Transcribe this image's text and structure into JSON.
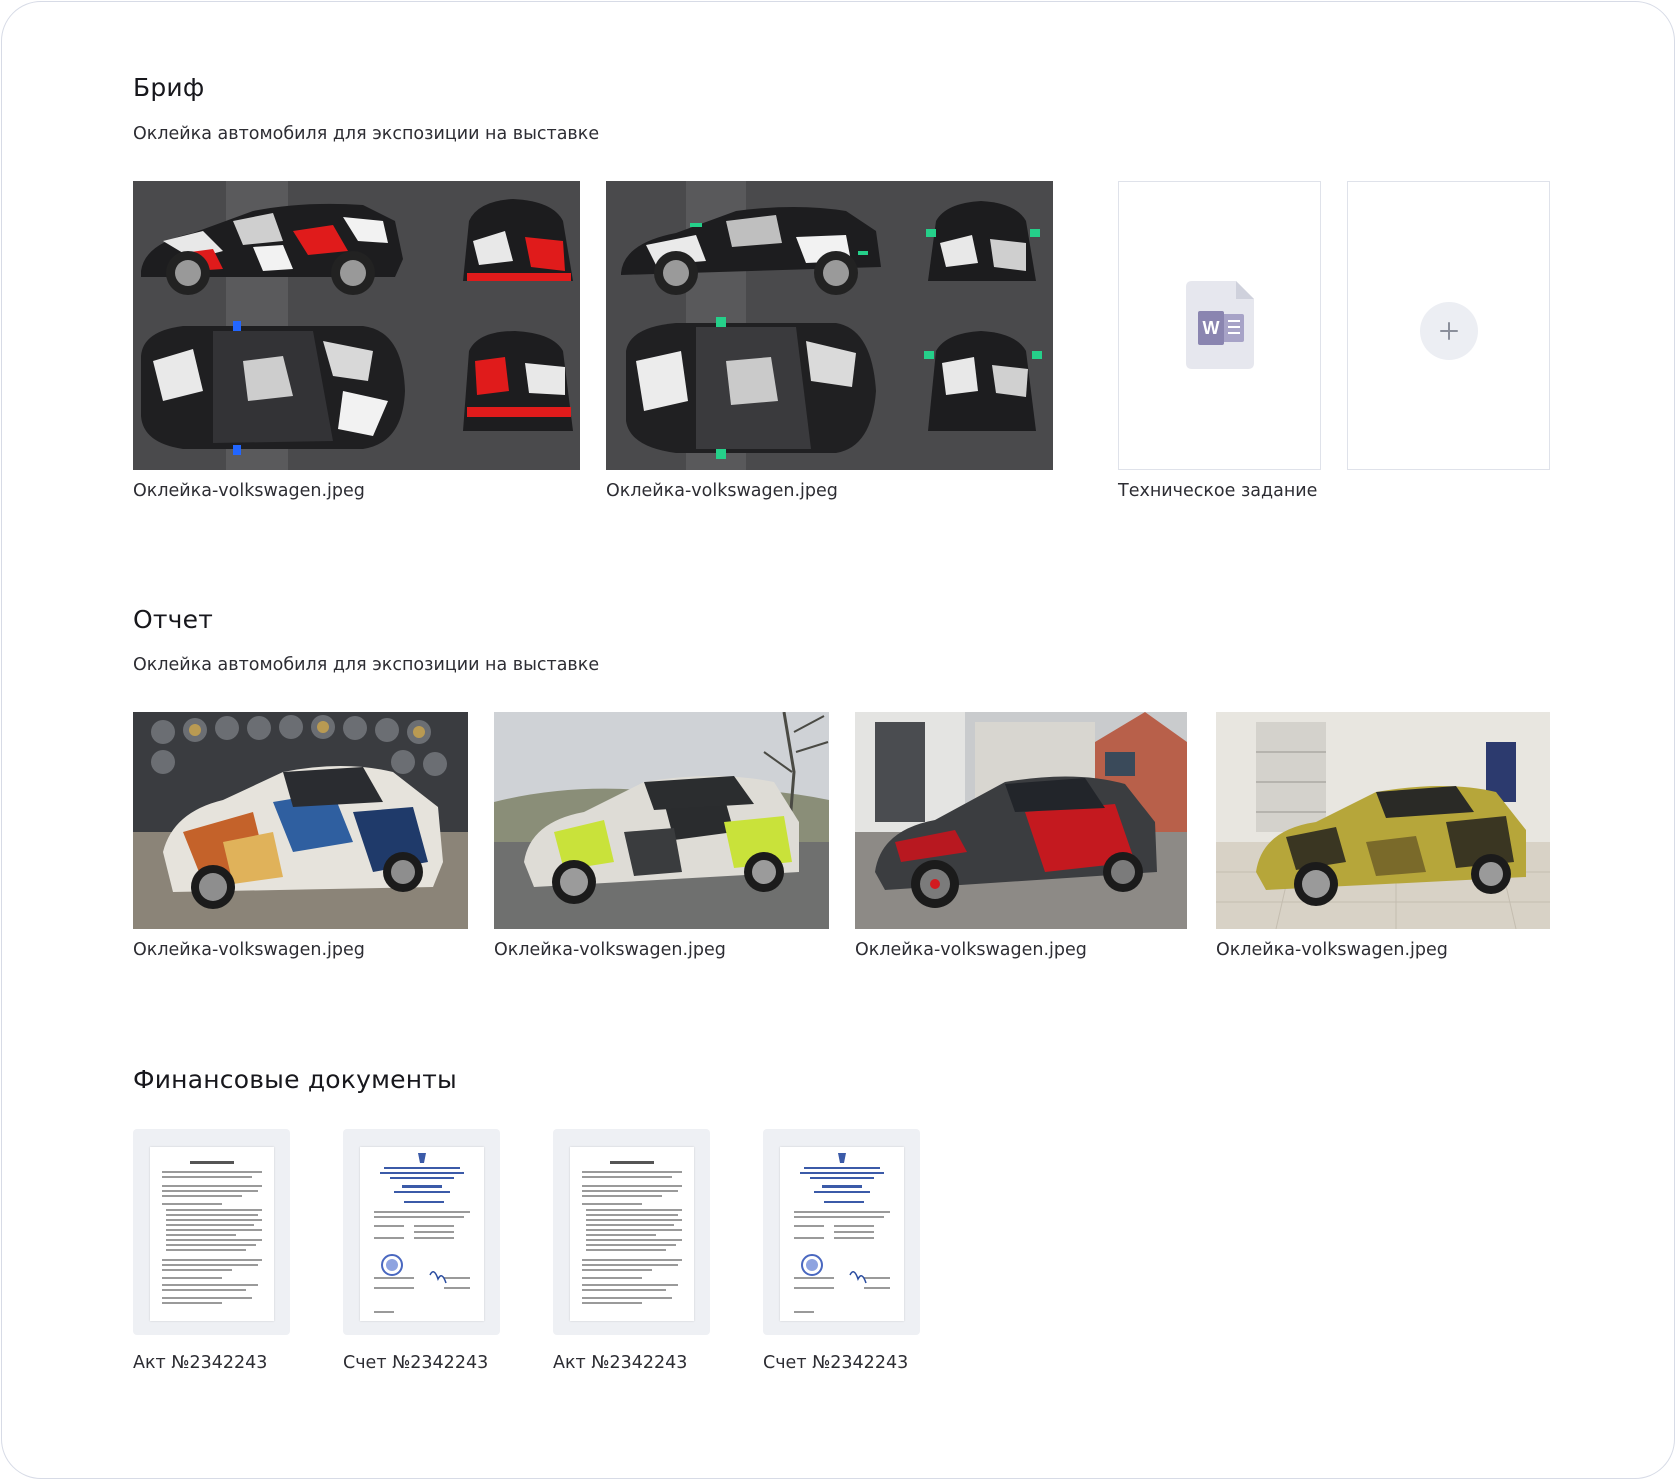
{
  "brief": {
    "title": "Бриф",
    "subtitle": "Оклейка автомобиля для экспозиции на выставке",
    "files": [
      {
        "name": "Оклейка-volkswagen.jpeg",
        "kind": "image"
      },
      {
        "name": "Оклейка-volkswagen.jpeg",
        "kind": "image"
      },
      {
        "name": "Техническое задание",
        "kind": "word-document",
        "icon": "word-icon"
      }
    ],
    "add_icon": "plus-icon"
  },
  "report": {
    "title": "Отчет",
    "subtitle": "Оклейка автомобиля для экспозиции на выставке",
    "files": [
      {
        "name": "Оклейка-volkswagen.jpeg"
      },
      {
        "name": "Оклейка-volkswagen.jpeg"
      },
      {
        "name": "Оклейка-volkswagen.jpeg"
      },
      {
        "name": "Оклейка-volkswagen.jpeg"
      }
    ]
  },
  "finance": {
    "title": "Финансовые документы",
    "files": [
      {
        "name": "Акт №2342243"
      },
      {
        "name": "Счет №2342243"
      },
      {
        "name": "Акт №2342243"
      },
      {
        "name": "Счет №2342243"
      }
    ]
  },
  "colors": {
    "border": "#d7dbe6",
    "tile_bg": "#eef0f4",
    "word_icon": "#8a85b0",
    "text": "#2d2d33"
  }
}
